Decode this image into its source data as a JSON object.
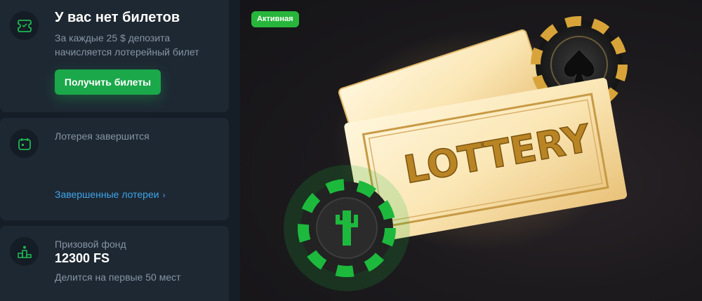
{
  "tickets_card": {
    "title": "У вас нет билетов",
    "description": "За каждые 25 $ депозита начисляется лотерейный билет",
    "button_label": "Получить билеты",
    "icon": "ticket-icon"
  },
  "end_card": {
    "label": "Лотерея завершится",
    "link_label": "Завершенные лотереи",
    "link_chevron": "›",
    "icon": "calendar-icon"
  },
  "prize_card": {
    "label": "Призовой фонд",
    "value": "12300 FS",
    "note": "Делится на первые 50 мест",
    "icon": "podium-icon"
  },
  "banner": {
    "status_badge": "Активная",
    "ticket_word": "LOTTERY",
    "colors": {
      "badge": "#28b53c",
      "gold": "#c9921f",
      "chip_green": "#1db93d"
    }
  }
}
